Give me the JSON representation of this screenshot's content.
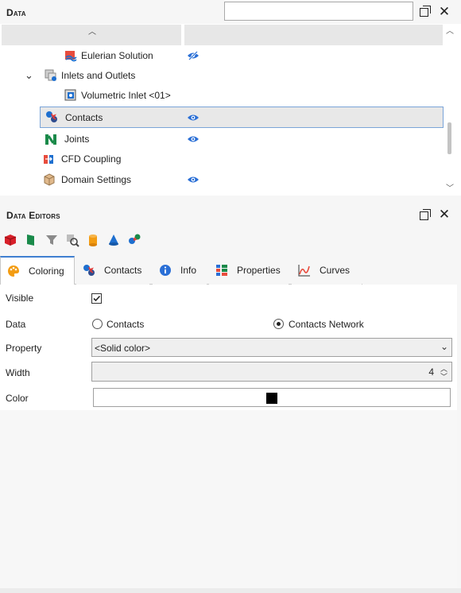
{
  "data_panel": {
    "title": "Data",
    "search": {
      "value": "",
      "placeholder": ""
    },
    "tree": [
      {
        "label": "Eulerian Solution",
        "icon": "eulerian-icon",
        "visible_icon": "eye-hidden-icon"
      },
      {
        "label": "Inlets and Outlets",
        "icon": "inlets-icon",
        "expanded": true
      },
      {
        "label": "Volumetric Inlet <01>",
        "icon": "volumetric-inlet-icon"
      },
      {
        "label": "Contacts",
        "icon": "contacts-icon",
        "visible_icon": "eye-icon",
        "selected": true
      },
      {
        "label": "Joints",
        "icon": "joints-icon",
        "visible_icon": "eye-icon"
      },
      {
        "label": "CFD Coupling",
        "icon": "cfd-coupling-icon"
      },
      {
        "label": "Domain Settings",
        "icon": "domain-settings-icon",
        "visible_icon": "eye-icon"
      }
    ]
  },
  "editors_panel": {
    "title": "Data Editors",
    "toolbar": [
      "red-cube-icon",
      "green-flag-icon",
      "filter-icon",
      "search-zoom-icon",
      "cylinder-icon",
      "cone-icon",
      "contacts-small-icon"
    ],
    "tabs": [
      {
        "label": "Coloring",
        "icon": "palette-icon",
        "active": true
      },
      {
        "label": "Contacts",
        "icon": "contacts-icon"
      },
      {
        "label": "Info",
        "icon": "info-icon"
      },
      {
        "label": "Properties",
        "icon": "properties-icon"
      },
      {
        "label": "Curves",
        "icon": "curves-icon"
      }
    ],
    "properties": {
      "visible_label": "Visible",
      "visible_checked": true,
      "data_label": "Data",
      "data_options": [
        "Contacts",
        "Contacts Network"
      ],
      "data_selected": "Contacts Network",
      "property_label": "Property",
      "property_value": "<Solid color>",
      "width_label": "Width",
      "width_value": "4",
      "color_label": "Color",
      "color_value": "#000000"
    }
  },
  "colors": {
    "accent": "#3f7fd0",
    "eye": "#2a6fd6",
    "selection_border": "#7aa4d8"
  }
}
